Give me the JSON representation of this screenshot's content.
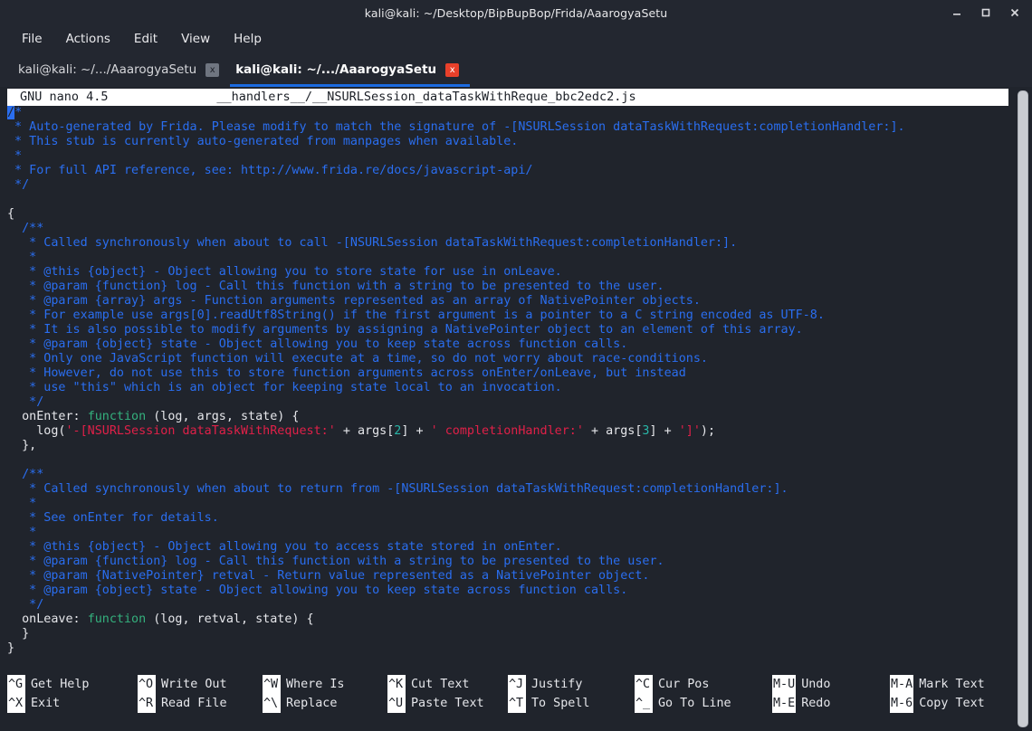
{
  "window": {
    "title": "kali@kali: ~/Desktop/BipBupBop/Frida/AaarogyaSetu",
    "controls": {
      "minimize": "minimize-icon",
      "maximize": "maximize-icon",
      "close": "close-icon"
    }
  },
  "menubar": {
    "items": [
      "File",
      "Actions",
      "Edit",
      "View",
      "Help"
    ]
  },
  "tabs": [
    {
      "label": "kali@kali: ~/.../AaarogyaSetu",
      "active": false,
      "close": "x"
    },
    {
      "label": "kali@kali: ~/.../AaarogyaSetu",
      "active": true,
      "close": "x"
    }
  ],
  "nano": {
    "version": "GNU nano 4.5",
    "filename": "__handlers__/__NSURLSession_dataTaskWithReque_bbc2edc2.js",
    "lines": [
      [
        {
          "t": "/",
          "c": "cursor"
        },
        {
          "t": "*",
          "c": "c-comment"
        }
      ],
      [
        {
          "t": " * Auto-generated by Frida. Please modify to match the signature of -[NSURLSession dataTaskWithRequest:completionHandler:].",
          "c": "c-comment"
        }
      ],
      [
        {
          "t": " * This stub is currently auto-generated from manpages when available.",
          "c": "c-comment"
        }
      ],
      [
        {
          "t": " *",
          "c": "c-comment"
        }
      ],
      [
        {
          "t": " * For full API reference, see: http://www.frida.re/docs/javascript-api/",
          "c": "c-comment"
        }
      ],
      [
        {
          "t": " */",
          "c": "c-comment"
        }
      ],
      [
        {
          "t": "",
          "c": "c-plain"
        }
      ],
      [
        {
          "t": "{",
          "c": "c-plain"
        }
      ],
      [
        {
          "t": "  /**",
          "c": "c-comment"
        }
      ],
      [
        {
          "t": "   * Called synchronously when about to call -[NSURLSession dataTaskWithRequest:completionHandler:].",
          "c": "c-comment"
        }
      ],
      [
        {
          "t": "   *",
          "c": "c-comment"
        }
      ],
      [
        {
          "t": "   * @this {object} - Object allowing you to store state for use in onLeave.",
          "c": "c-comment"
        }
      ],
      [
        {
          "t": "   * @param {function} log - Call this function with a string to be presented to the user.",
          "c": "c-comment"
        }
      ],
      [
        {
          "t": "   * @param {array} args - Function arguments represented as an array of NativePointer objects.",
          "c": "c-comment"
        }
      ],
      [
        {
          "t": "   * For example use args[0].readUtf8String() if the first argument is a pointer to a C string encoded as UTF-8.",
          "c": "c-comment"
        }
      ],
      [
        {
          "t": "   * It is also possible to modify arguments by assigning a NativePointer object to an element of this array.",
          "c": "c-comment"
        }
      ],
      [
        {
          "t": "   * @param {object} state - Object allowing you to keep state across function calls.",
          "c": "c-comment"
        }
      ],
      [
        {
          "t": "   * Only one JavaScript function will execute at a time, so do not worry about race-conditions.",
          "c": "c-comment"
        }
      ],
      [
        {
          "t": "   * However, do not use this to store function arguments across onEnter/onLeave, but instead",
          "c": "c-comment"
        }
      ],
      [
        {
          "t": "   * use \"this\" which is an object for keeping state local to an invocation.",
          "c": "c-comment"
        }
      ],
      [
        {
          "t": "   */",
          "c": "c-comment"
        }
      ],
      [
        {
          "t": "  onEnter: ",
          "c": "c-plain"
        },
        {
          "t": "function",
          "c": "c-kw"
        },
        {
          "t": " (log, args, state) {",
          "c": "c-plain"
        }
      ],
      [
        {
          "t": "    log(",
          "c": "c-plain"
        },
        {
          "t": "'-[NSURLSession dataTaskWithRequest:'",
          "c": "c-str"
        },
        {
          "t": " + args[",
          "c": "c-plain"
        },
        {
          "t": "2",
          "c": "c-num"
        },
        {
          "t": "] + ",
          "c": "c-plain"
        },
        {
          "t": "' completionHandler:'",
          "c": "c-str"
        },
        {
          "t": " + args[",
          "c": "c-plain"
        },
        {
          "t": "3",
          "c": "c-num"
        },
        {
          "t": "] + ",
          "c": "c-plain"
        },
        {
          "t": "']'",
          "c": "c-str"
        },
        {
          "t": ");",
          "c": "c-plain"
        }
      ],
      [
        {
          "t": "  },",
          "c": "c-plain"
        }
      ],
      [
        {
          "t": "",
          "c": "c-plain"
        }
      ],
      [
        {
          "t": "  /**",
          "c": "c-comment"
        }
      ],
      [
        {
          "t": "   * Called synchronously when about to return from -[NSURLSession dataTaskWithRequest:completionHandler:].",
          "c": "c-comment"
        }
      ],
      [
        {
          "t": "   *",
          "c": "c-comment"
        }
      ],
      [
        {
          "t": "   * See onEnter for details.",
          "c": "c-comment"
        }
      ],
      [
        {
          "t": "   *",
          "c": "c-comment"
        }
      ],
      [
        {
          "t": "   * @this {object} - Object allowing you to access state stored in onEnter.",
          "c": "c-comment"
        }
      ],
      [
        {
          "t": "   * @param {function} log - Call this function with a string to be presented to the user.",
          "c": "c-comment"
        }
      ],
      [
        {
          "t": "   * @param {NativePointer} retval - Return value represented as a NativePointer object.",
          "c": "c-comment"
        }
      ],
      [
        {
          "t": "   * @param {object} state - Object allowing you to keep state across function calls.",
          "c": "c-comment"
        }
      ],
      [
        {
          "t": "   */",
          "c": "c-comment"
        }
      ],
      [
        {
          "t": "  onLeave: ",
          "c": "c-plain"
        },
        {
          "t": "function",
          "c": "c-kw"
        },
        {
          "t": " (log, retval, state) {",
          "c": "c-plain"
        }
      ],
      [
        {
          "t": "  }",
          "c": "c-plain"
        }
      ],
      [
        {
          "t": "}",
          "c": "c-plain"
        }
      ]
    ],
    "shortcuts": [
      {
        "key1": "^G",
        "label1": "Get Help",
        "key2": "^X",
        "label2": "Exit"
      },
      {
        "key1": "^O",
        "label1": "Write Out",
        "key2": "^R",
        "label2": "Read File"
      },
      {
        "key1": "^W",
        "label1": "Where Is",
        "key2": "^\\",
        "label2": "Replace"
      },
      {
        "key1": "^K",
        "label1": "Cut Text",
        "key2": "^U",
        "label2": "Paste Text"
      },
      {
        "key1": "^J",
        "label1": "Justify",
        "key2": "^T",
        "label2": "To Spell"
      },
      {
        "key1": "^C",
        "label1": "Cur Pos",
        "key2": "^_",
        "label2": "Go To Line"
      },
      {
        "key1": "M-U",
        "label1": "Undo",
        "key2": "M-E",
        "label2": "Redo"
      },
      {
        "key1": "M-A",
        "label1": "Mark Text",
        "key2": "M-6",
        "label2": "Copy Text"
      }
    ]
  },
  "colors": {
    "accent": "#1b6ae0",
    "comment": "#2a6ef0",
    "keyword": "#34b07d",
    "string": "#e02048",
    "number": "#29b6a8",
    "close_active": "#e8402a",
    "terminal_bg": "#20242c",
    "chrome_bg": "#232730"
  }
}
